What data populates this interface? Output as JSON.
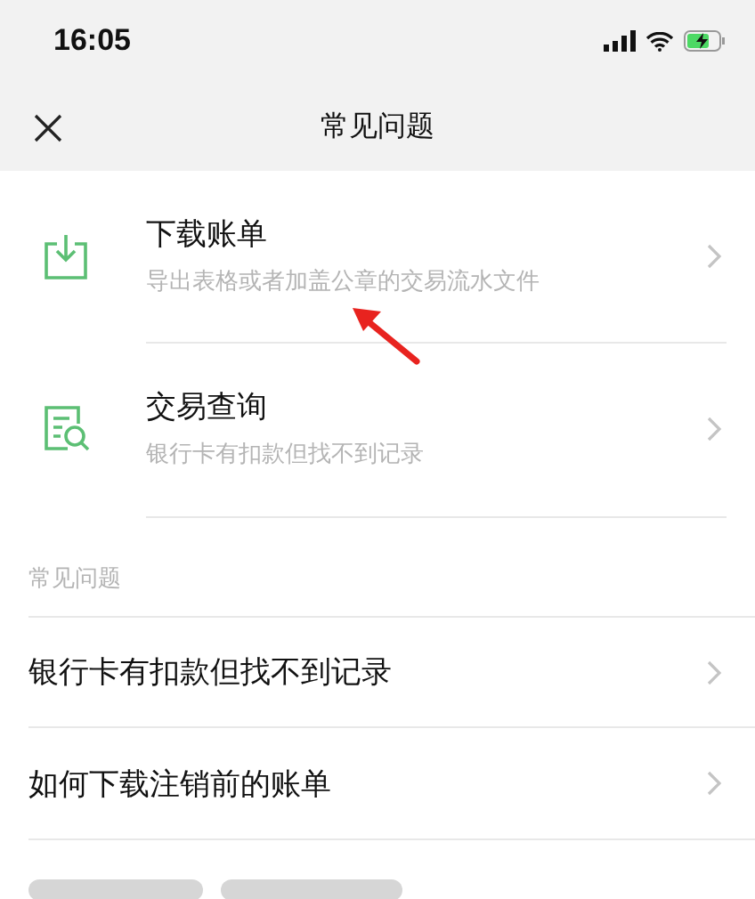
{
  "status_bar": {
    "time": "16:05"
  },
  "header": {
    "title": "常见问题"
  },
  "services": [
    {
      "kind": "download",
      "title": "下载账单",
      "subtitle": "导出表格或者加盖公章的交易流水文件"
    },
    {
      "kind": "search",
      "title": "交易查询",
      "subtitle": "银行卡有扣款但找不到记录"
    }
  ],
  "faq": {
    "heading": "常见问题",
    "items": [
      "银行卡有扣款但找不到记录",
      "如何下载注销前的账单"
    ]
  }
}
